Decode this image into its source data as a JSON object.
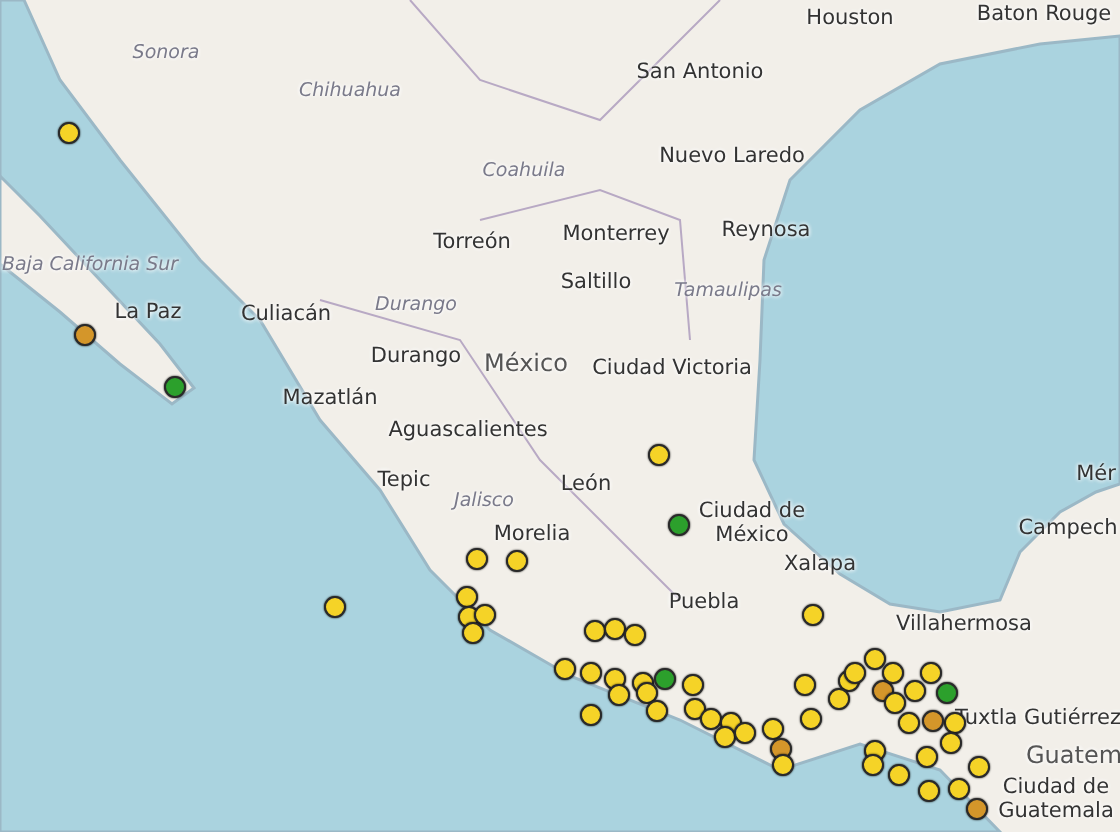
{
  "map": {
    "labels": [
      {
        "text": "Sonora",
        "kind": "region"
      },
      {
        "text": "Chihuahua",
        "kind": "region"
      },
      {
        "text": "Coahuila",
        "kind": "region"
      },
      {
        "text": "Baja California Sur",
        "kind": "region"
      },
      {
        "text": "Houston",
        "kind": "city"
      },
      {
        "text": "Baton Rouge",
        "kind": "city"
      },
      {
        "text": "San Antonio",
        "kind": "city"
      },
      {
        "text": "Nuevo Laredo",
        "kind": "city"
      },
      {
        "text": "Reynosa",
        "kind": "city"
      },
      {
        "text": "Torreón",
        "kind": "city"
      },
      {
        "text": "Monterrey",
        "kind": "city"
      },
      {
        "text": "Saltillo",
        "kind": "city"
      },
      {
        "text": "Tamaulipas",
        "kind": "region"
      },
      {
        "text": "La Paz",
        "kind": "city"
      },
      {
        "text": "Culiacán",
        "kind": "city"
      },
      {
        "text": "Durango",
        "kind": "region"
      },
      {
        "text": "Durango",
        "kind": "city"
      },
      {
        "text": "México",
        "kind": "country"
      },
      {
        "text": "Ciudad Victoria",
        "kind": "city"
      },
      {
        "text": "Mazatlán",
        "kind": "city"
      },
      {
        "text": "Aguascalientes",
        "kind": "city"
      },
      {
        "text": "Tepic",
        "kind": "city"
      },
      {
        "text": "Jalisco",
        "kind": "region"
      },
      {
        "text": "León",
        "kind": "city"
      },
      {
        "text": "Morelia",
        "kind": "city"
      },
      {
        "text": "Ciudad de México",
        "kind": "city"
      },
      {
        "text": "Xalapa",
        "kind": "city"
      },
      {
        "text": "Puebla",
        "kind": "city"
      },
      {
        "text": "Mér",
        "kind": "city"
      },
      {
        "text": "Campech",
        "kind": "city"
      },
      {
        "text": "Villahermosa",
        "kind": "city"
      },
      {
        "text": "Tuxtla Gutiérrez",
        "kind": "city"
      },
      {
        "text": "Guatem",
        "kind": "country"
      },
      {
        "text": "Ciudad de Guatemala",
        "kind": "city"
      }
    ],
    "markers": [
      {
        "color": "#f5d327"
      },
      {
        "color": "#d4962a"
      },
      {
        "color": "#2ca02c"
      },
      {
        "color": "#f5d327"
      },
      {
        "color": "#f5d327"
      },
      {
        "color": "#f5d327"
      },
      {
        "color": "#f5d327"
      },
      {
        "color": "#f5d327"
      },
      {
        "color": "#f5d327"
      },
      {
        "color": "#f5d327"
      },
      {
        "color": "#f5d327"
      },
      {
        "color": "#2ca02c"
      },
      {
        "color": "#f5d327"
      },
      {
        "color": "#f5d327"
      },
      {
        "color": "#f5d327"
      },
      {
        "color": "#f5d327"
      },
      {
        "color": "#f5d327"
      },
      {
        "color": "#f5d327"
      },
      {
        "color": "#f5d327"
      },
      {
        "color": "#2ca02c"
      },
      {
        "color": "#f5d327"
      },
      {
        "color": "#f5d327"
      },
      {
        "color": "#f5d327"
      },
      {
        "color": "#f5d327"
      },
      {
        "color": "#f5d327"
      },
      {
        "color": "#f5d327"
      },
      {
        "color": "#f5d327"
      },
      {
        "color": "#f5d327"
      },
      {
        "color": "#f5d327"
      },
      {
        "color": "#f5d327"
      },
      {
        "color": "#f5d327"
      },
      {
        "color": "#d4962a"
      },
      {
        "color": "#f5d327"
      },
      {
        "color": "#f5d327"
      },
      {
        "color": "#f5d327"
      },
      {
        "color": "#f5d327"
      },
      {
        "color": "#f5d327"
      },
      {
        "color": "#f5d327"
      },
      {
        "color": "#f5d327"
      },
      {
        "color": "#f5d327"
      },
      {
        "color": "#d4962a"
      },
      {
        "color": "#f5d327"
      },
      {
        "color": "#f5d327"
      },
      {
        "color": "#f5d327"
      },
      {
        "color": "#f5d327"
      },
      {
        "color": "#f5d327"
      },
      {
        "color": "#f5d327"
      },
      {
        "color": "#d4962a"
      },
      {
        "color": "#f5d327"
      },
      {
        "color": "#f5d327"
      },
      {
        "color": "#f5d327"
      },
      {
        "color": "#2ca02c"
      },
      {
        "color": "#f5d327"
      },
      {
        "color": "#f5d327"
      },
      {
        "color": "#f5d327"
      },
      {
        "color": "#f5d327"
      },
      {
        "color": "#f5d327"
      },
      {
        "color": "#d4962a"
      }
    ]
  }
}
